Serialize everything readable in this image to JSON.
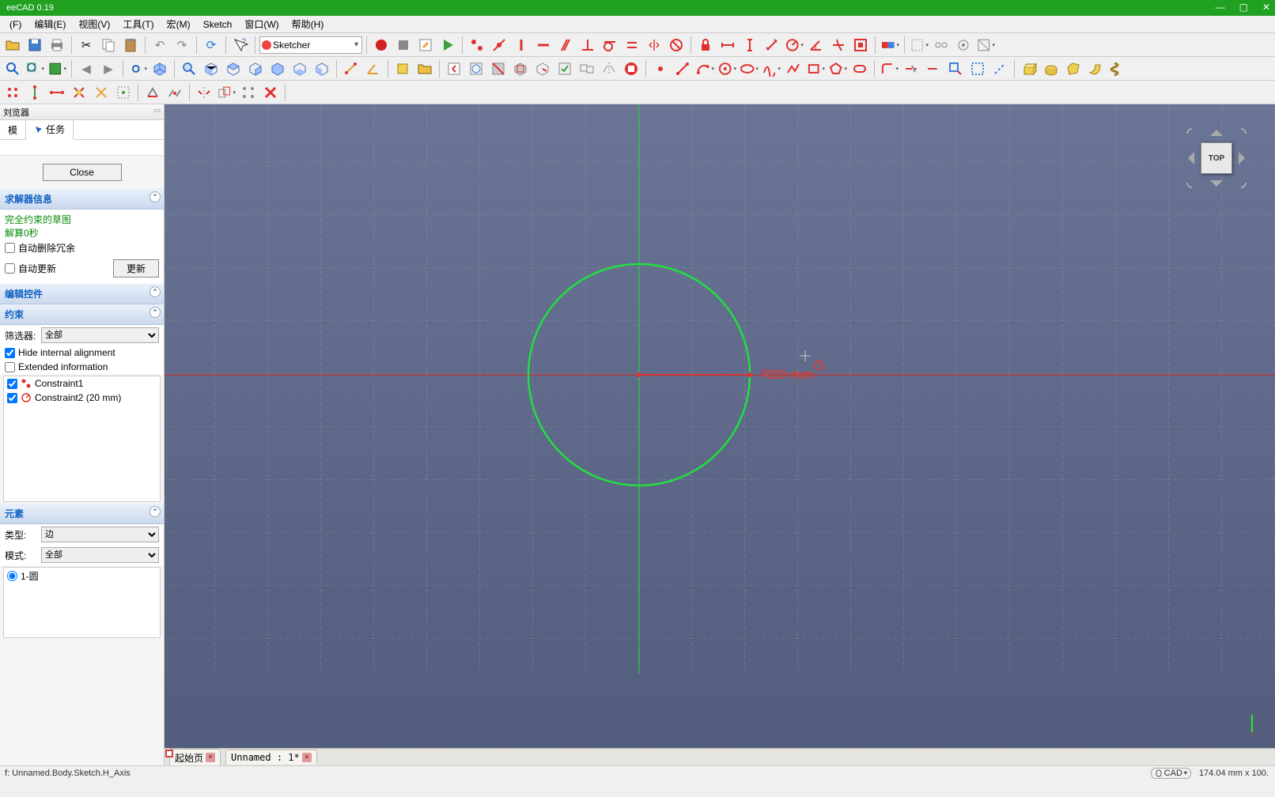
{
  "title": "eeCAD 0.19",
  "menu": [
    "(F)",
    "编辑(E)",
    "视图(V)",
    "工具(T)",
    "宏(M)",
    "Sketch",
    "窗口(W)",
    "帮助(H)"
  ],
  "workbench": "Sketcher",
  "panel_title": "刘览器",
  "tabs": {
    "model": "模",
    "task": "任务"
  },
  "close_btn": "Close",
  "solver": {
    "header": "求解器信息",
    "status1": "完全约束的草图",
    "status2": "解算0秒",
    "auto_del": "自动删除冗余",
    "auto_upd": "自动更新",
    "update_btn": "更新"
  },
  "edit_ctrl_hdr": "编辑控件",
  "constraints": {
    "header": "约束",
    "filter_label": "筛选器:",
    "filter_value": "全部",
    "hide_int": "Hide internal alignment",
    "ext_info": "Extended information",
    "items": [
      {
        "name": "Constraint1",
        "icon": "coincident"
      },
      {
        "name": "Constraint2 (20 mm)",
        "icon": "radius"
      }
    ]
  },
  "elements": {
    "header": "元素",
    "type_label": "类型:",
    "type_value": "边",
    "mode_label": "模式:",
    "mode_value": "全部",
    "items": [
      "1-圆"
    ]
  },
  "sketch": {
    "radius_label": "R20 mm"
  },
  "nav_cube": "TOP",
  "doc_tabs": [
    "起始页",
    "Unnamed : 1*"
  ],
  "status": {
    "left": "f: Unnamed.Body.Sketch.H_Axis",
    "nav": "CAD",
    "dims": "174.04 mm x 100."
  }
}
